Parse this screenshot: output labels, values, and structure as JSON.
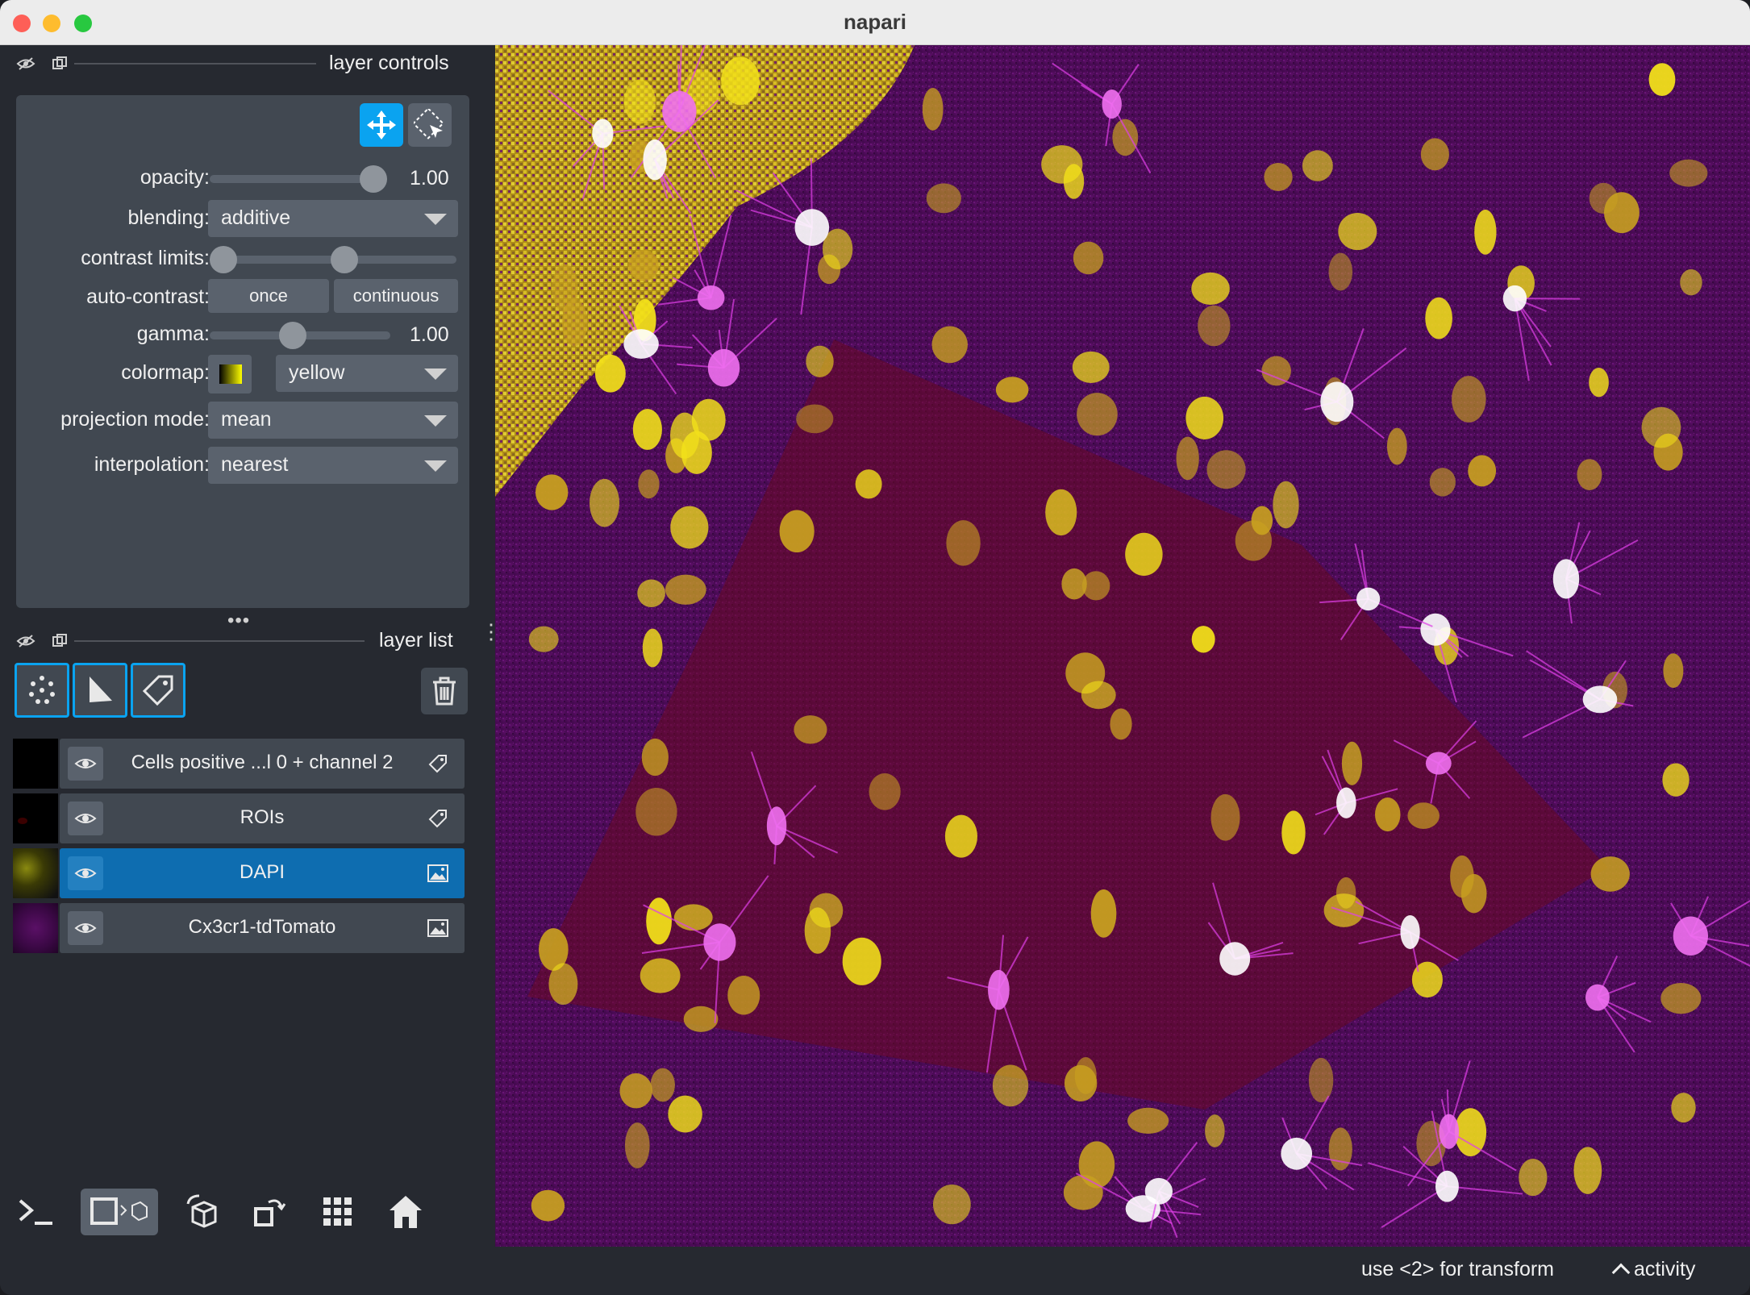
{
  "window": {
    "title": "napari"
  },
  "layer_controls": {
    "title": "layer controls",
    "opacity": {
      "label": "opacity:",
      "value": "1.00",
      "level": 1.0
    },
    "blending": {
      "label": "blending:",
      "value": "additive"
    },
    "contrast_limits": {
      "label": "contrast limits:",
      "low": 0.0,
      "high": 0.55
    },
    "auto_contrast": {
      "label": "auto-contrast:",
      "once": "once",
      "continuous": "continuous"
    },
    "gamma": {
      "label": "gamma:",
      "value": "1.00",
      "level": 0.45
    },
    "colormap": {
      "label": "colormap:",
      "value": "yellow"
    },
    "projection_mode": {
      "label": "projection mode:",
      "value": "mean"
    },
    "interpolation": {
      "label": "interpolation:",
      "value": "nearest"
    }
  },
  "layer_list": {
    "title": "layer list",
    "layers": [
      {
        "name": "Cells positive ...l 0 + channel 2",
        "type": "labels",
        "visible": true,
        "selected": false
      },
      {
        "name": "ROIs",
        "type": "labels",
        "visible": true,
        "selected": false
      },
      {
        "name": "DAPI",
        "type": "image",
        "visible": true,
        "selected": true
      },
      {
        "name": "Cx3cr1-tdTomato",
        "type": "image",
        "visible": true,
        "selected": false
      }
    ]
  },
  "status": {
    "message": "use <2> for transform",
    "activity": "activity"
  },
  "colors": {
    "accent": "#0aa3f0",
    "selected": "#0e6db0",
    "panel": "#414851",
    "background": "#262930"
  }
}
